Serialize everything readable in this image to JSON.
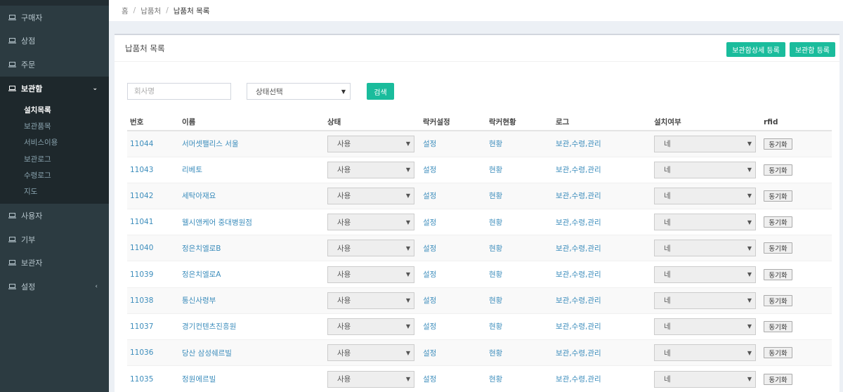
{
  "sidebar": {
    "items": [
      {
        "label": "구매자"
      },
      {
        "label": "상점"
      },
      {
        "label": "주문"
      },
      {
        "label": "보관함"
      },
      {
        "label": "사용자"
      },
      {
        "label": "기부"
      },
      {
        "label": "보관자"
      },
      {
        "label": "설정"
      }
    ],
    "submenu": [
      {
        "label": "설치목록"
      },
      {
        "label": "보관품목"
      },
      {
        "label": "서비스이용"
      },
      {
        "label": "보관로그"
      },
      {
        "label": "수령로그"
      },
      {
        "label": "지도"
      }
    ],
    "expanded_chevron": "⌄",
    "collapsed_chevron": "‹"
  },
  "breadcrumb": {
    "home": "홈",
    "sep": "/",
    "level1": "납품처",
    "current": "납품처 목록"
  },
  "box": {
    "title": "납품처 목록",
    "btn_register_detail": "보관함상세 등록",
    "btn_register": "보관함 등록"
  },
  "search": {
    "company_placeholder": "회사명",
    "status_select": "상태선택",
    "button": "검색"
  },
  "table": {
    "headers": {
      "no": "번호",
      "name": "이름",
      "status": "상태",
      "rack_setting": "락커설정",
      "rack_status": "락커현황",
      "log": "로그",
      "install": "설치여부",
      "rfid": "rfid"
    },
    "rows": [
      {
        "no": "11044",
        "name": "서머셋팰리스 서울",
        "status": "사용",
        "setting": "설정",
        "current": "현황",
        "log": "보관,수령,관리",
        "install": "네",
        "rfid": "동기화"
      },
      {
        "no": "11043",
        "name": "리베토",
        "status": "사용",
        "setting": "설정",
        "current": "현황",
        "log": "보관,수령,관리",
        "install": "네",
        "rfid": "동기화"
      },
      {
        "no": "11042",
        "name": "세탁아재요",
        "status": "사용",
        "setting": "설정",
        "current": "현황",
        "log": "보관,수령,관리",
        "install": "네",
        "rfid": "동기화"
      },
      {
        "no": "11041",
        "name": "웰시앤케어 중대병원점",
        "status": "사용",
        "setting": "설정",
        "current": "현황",
        "log": "보관,수령,관리",
        "install": "네",
        "rfid": "동기화"
      },
      {
        "no": "11040",
        "name": "정은치엘로B",
        "status": "사용",
        "setting": "설정",
        "current": "현황",
        "log": "보관,수령,관리",
        "install": "네",
        "rfid": "동기화"
      },
      {
        "no": "11039",
        "name": "정은치엘로A",
        "status": "사용",
        "setting": "설정",
        "current": "현황",
        "log": "보관,수령,관리",
        "install": "네",
        "rfid": "동기화"
      },
      {
        "no": "11038",
        "name": "통신사령부",
        "status": "사용",
        "setting": "설정",
        "current": "현황",
        "log": "보관,수령,관리",
        "install": "네",
        "rfid": "동기화"
      },
      {
        "no": "11037",
        "name": "경기컨텐츠진흥원",
        "status": "사용",
        "setting": "설정",
        "current": "현황",
        "log": "보관,수령,관리",
        "install": "네",
        "rfid": "동기화"
      },
      {
        "no": "11036",
        "name": "당산 삼성쉐르빌",
        "status": "사용",
        "setting": "설정",
        "current": "현황",
        "log": "보관,수령,관리",
        "install": "네",
        "rfid": "동기화"
      },
      {
        "no": "11035",
        "name": "정원에르빌",
        "status": "사용",
        "setting": "설정",
        "current": "현황",
        "log": "보관,수령,관리",
        "install": "네",
        "rfid": "동기화"
      }
    ]
  },
  "icons": {
    "caret_down": "▼",
    "nav_icon": "laptop-icon"
  },
  "colors": {
    "sidebar_bg": "#2c3b41",
    "accent_green": "#1abc9c",
    "link_blue": "#3c8dbc"
  }
}
